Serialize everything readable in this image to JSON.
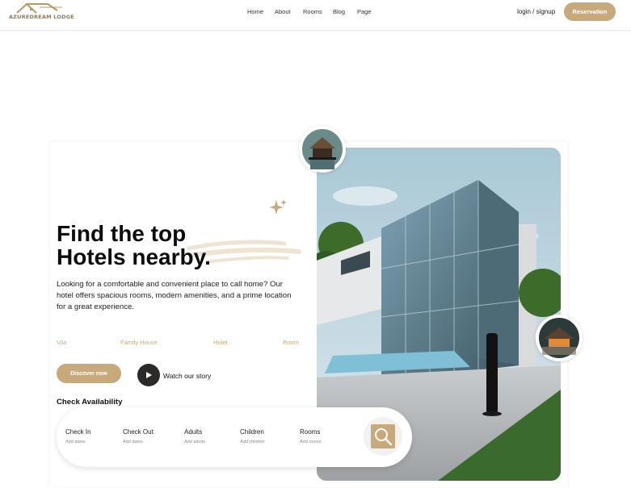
{
  "brand": {
    "name": "AZUREDREAM LODGE",
    "color": "#c7a97c"
  },
  "nav": {
    "items": [
      "Home",
      "About",
      "Rooms",
      "Blog",
      "Page"
    ],
    "login": "login / signup",
    "reservation": "Reservation"
  },
  "hero": {
    "headline_line1": "Find the top",
    "headline_line2": "Hotels nearby.",
    "description": "Looking for a comfortable and convenient place to call home? Our hotel offers spacious rooms, modern amenities, and a prime location for a great experience.",
    "categories": [
      "Vila",
      "Family House",
      "Hotel",
      "Room"
    ],
    "discover": "Discover now",
    "watch": "Watch our story"
  },
  "availability": {
    "title": "Check Availability",
    "fields": [
      {
        "label": "Check In",
        "placeholder": "Add dates"
      },
      {
        "label": "Check Out",
        "placeholder": "Add dates"
      },
      {
        "label": "Adults",
        "placeholder": "Add adults"
      },
      {
        "label": "Children",
        "placeholder": "Add children"
      },
      {
        "label": "Rooms",
        "placeholder": "Add rooms"
      }
    ]
  },
  "icons": {
    "logo": "house-roof-icon",
    "sparkle": "sparkle-icon",
    "play": "play-icon",
    "search": "search-icon"
  }
}
